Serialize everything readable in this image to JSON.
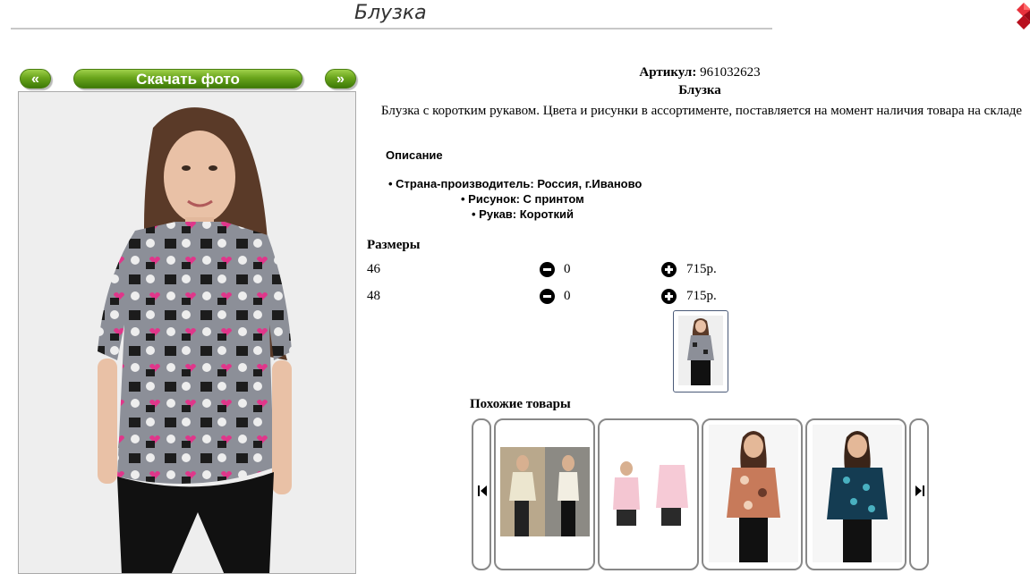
{
  "header": {
    "title": "Блузка"
  },
  "gallery": {
    "prev_label": "«",
    "download_label": "Скачать фото",
    "next_label": "»"
  },
  "product": {
    "article_label": "Артикул:",
    "article_value": "961032623",
    "name": "Блузка",
    "description": "Блузка с коротким рукавом. Цвета и рисунки в ассортименте, поставляется на момент наличия товара на складе"
  },
  "specs": {
    "heading": "Описание",
    "items": [
      "Страна-производитель: Россия, г.Иваново",
      "Рисунок: С принтом",
      "Рукав: Короткий"
    ]
  },
  "sizes": {
    "heading": "Размеры",
    "rows": [
      {
        "size": "46",
        "qty": "0",
        "price": "715р."
      },
      {
        "size": "48",
        "qty": "0",
        "price": "715р."
      }
    ]
  },
  "similar": {
    "heading": "Похожие товары"
  },
  "colors": {
    "button_green": "#6aa51c",
    "corner_red": "#d0142c"
  }
}
